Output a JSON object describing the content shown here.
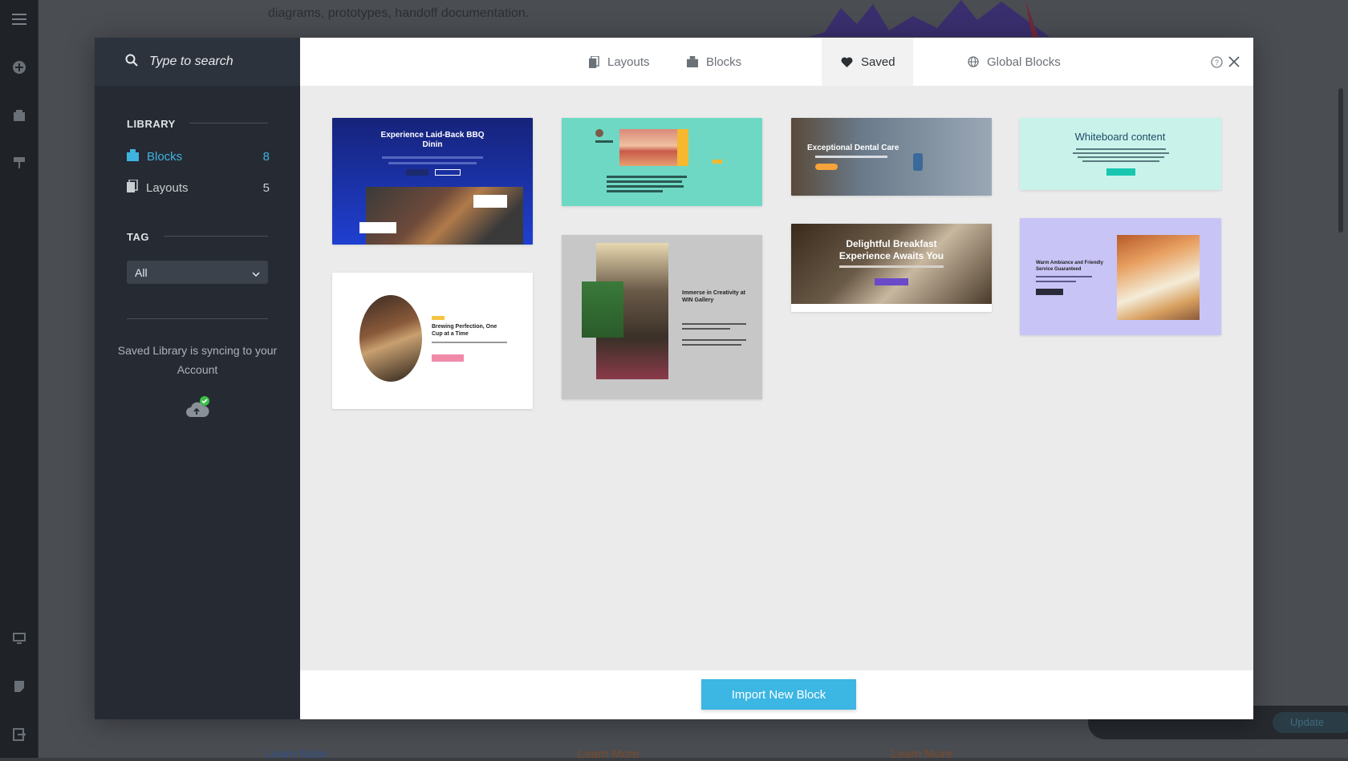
{
  "background": {
    "text": "diagrams, prototypes, handoff documentation.",
    "learn_more": [
      "Learn More",
      "Learn More",
      "Learn More"
    ],
    "update_label": "Update"
  },
  "search": {
    "placeholder": "Type to search"
  },
  "library": {
    "title": "LIBRARY",
    "items": [
      {
        "label": "Blocks",
        "count": "8",
        "icon": "block-icon"
      },
      {
        "label": "Layouts",
        "count": "5",
        "icon": "layouts-icon"
      }
    ]
  },
  "tag": {
    "title": "TAG",
    "selected": "All"
  },
  "sync": {
    "text": "Saved Library is syncing to your Account"
  },
  "tabs": [
    {
      "label": "Layouts",
      "icon": "layouts-icon"
    },
    {
      "label": "Blocks",
      "icon": "block-icon"
    },
    {
      "label": "Saved",
      "icon": "heart-icon"
    },
    {
      "label": "Global Blocks",
      "icon": "globe-icon"
    }
  ],
  "cards": [
    {
      "title": "Experience Laid-Back BBQ Dinin",
      "bg": "#1a2a8a"
    },
    {
      "title": "",
      "bg": "#6fd8c4"
    },
    {
      "title": "Exceptional Dental Care",
      "bg": "#4e5a6a"
    },
    {
      "title": "Whiteboard content",
      "bg": "#c9f3ea"
    },
    {
      "title": "Brewing Perfection, One Cup at a Time",
      "bg": "#ffffff"
    },
    {
      "title": "Immerse in Creativity at WIN Gallery",
      "bg": "#c7c7c7"
    },
    {
      "title": "Delightful Breakfast Experience Awaits You",
      "bg": "#5a4a3a"
    },
    {
      "title": "Warm Ambiance and Friendly Service Guaranteed",
      "bg": "#c9c4f6"
    }
  ],
  "footer": {
    "button": "Import New Block"
  },
  "colors": {
    "accent": "#3cb6e3",
    "sidebar": "#262b33",
    "sync_check": "#3cbf4a"
  }
}
